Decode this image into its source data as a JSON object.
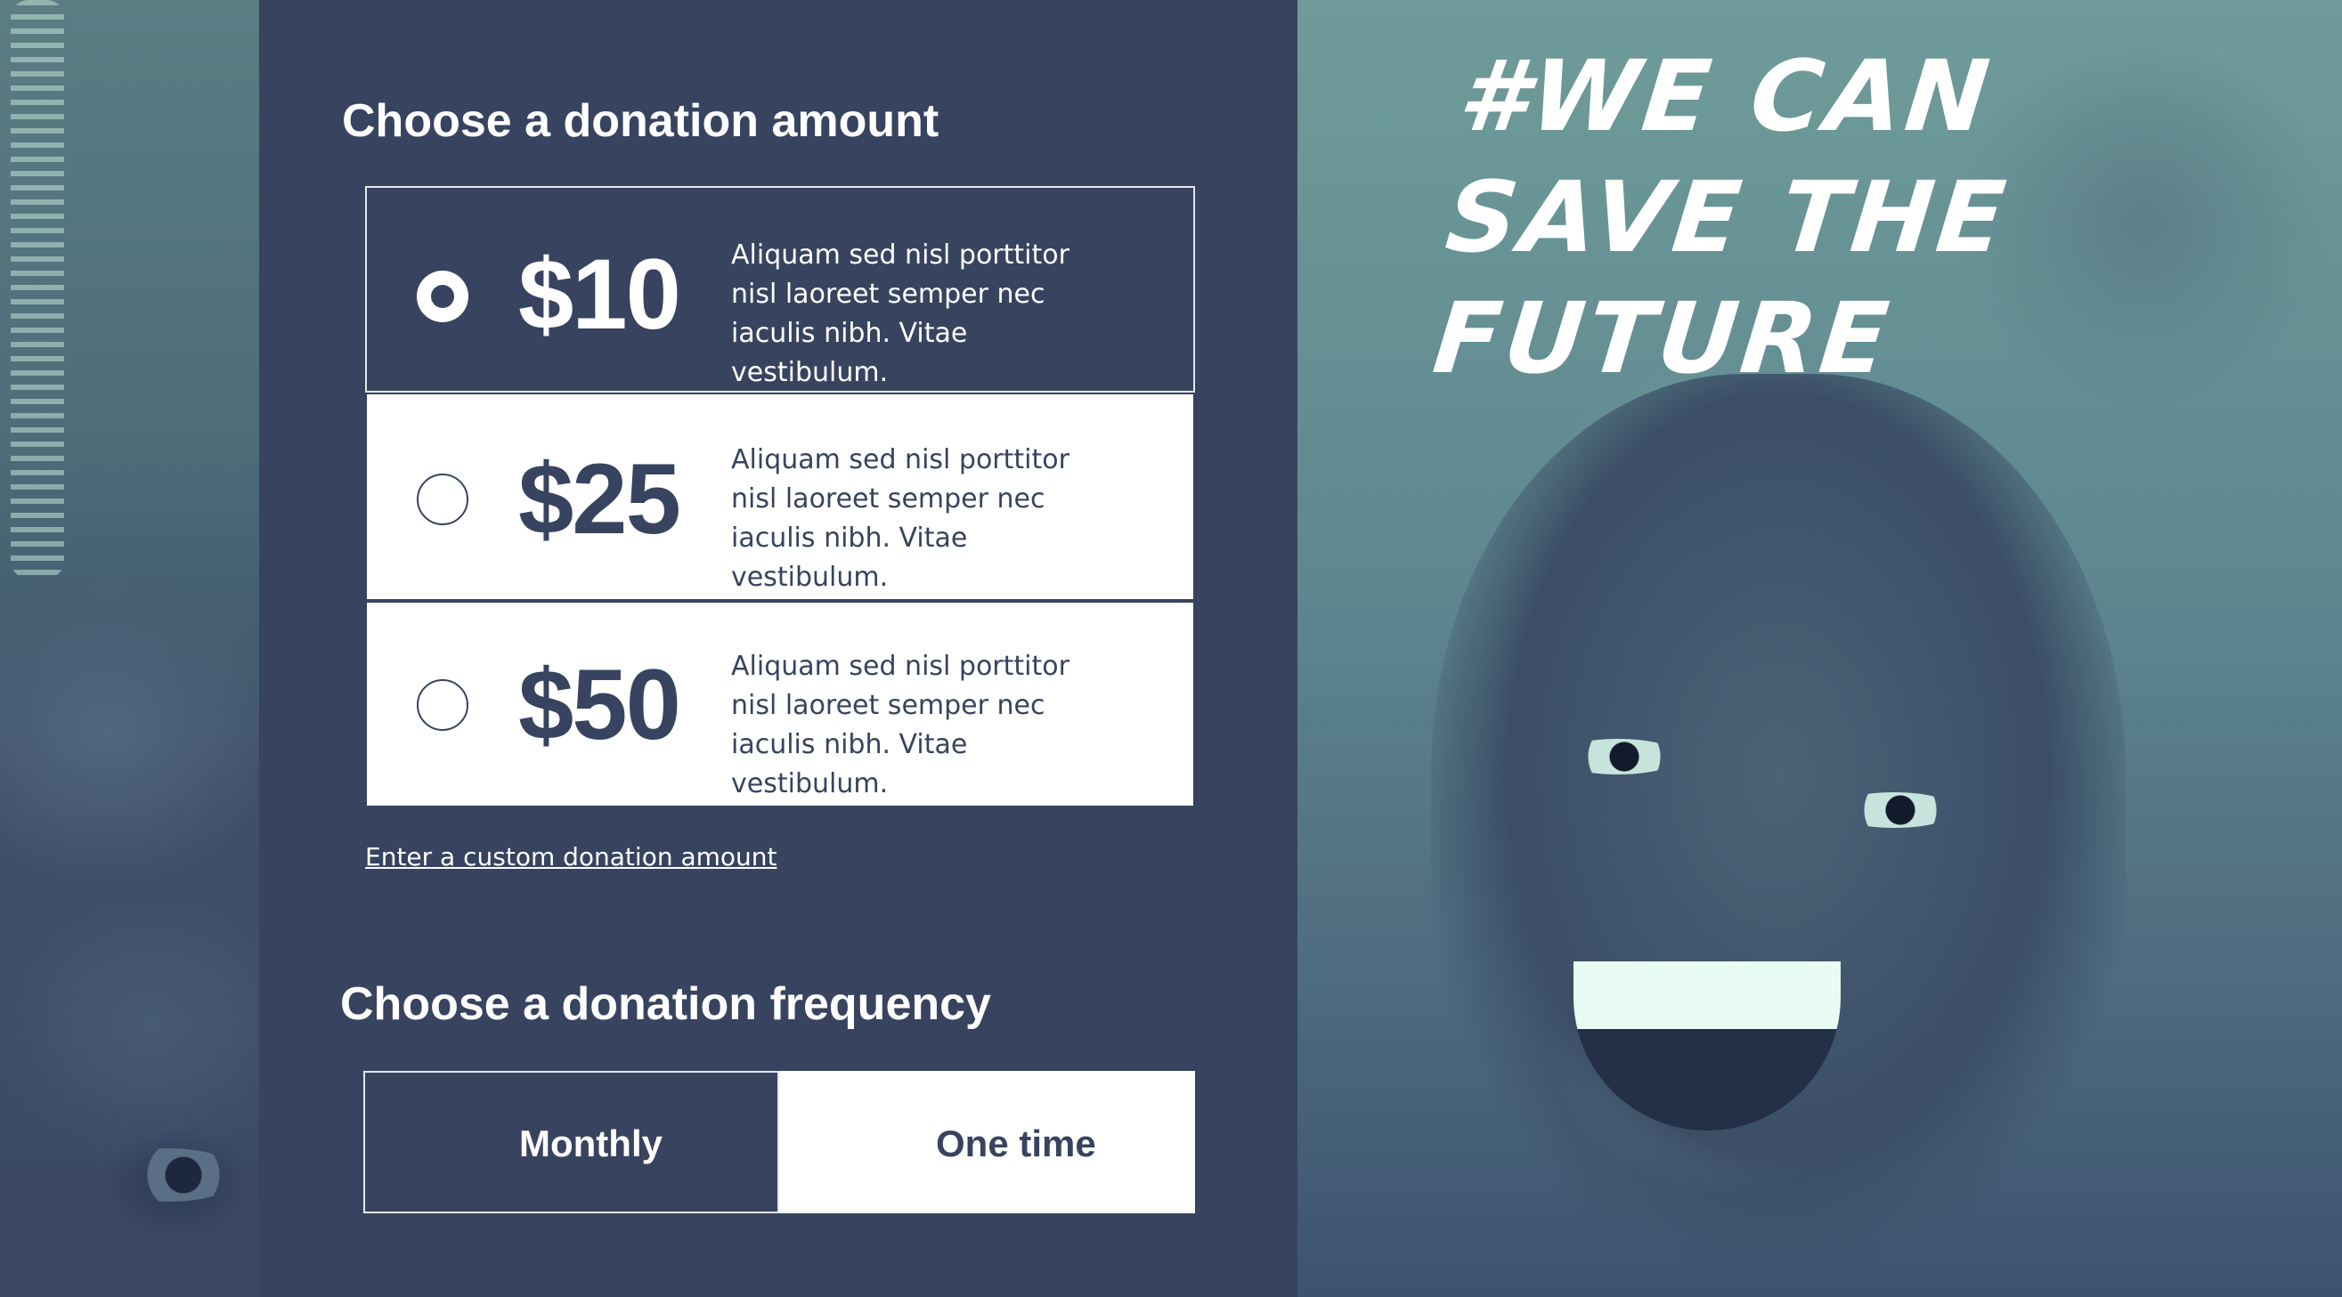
{
  "amount_section": {
    "title": "Choose a donation amount",
    "options": [
      {
        "amount": "$10",
        "description": "Aliquam sed nisl porttitor nisl laoreet semper nec iaculis nibh. Vitae vestibulum.",
        "selected": true
      },
      {
        "amount": "$25",
        "description": "Aliquam sed nisl porttitor nisl laoreet semper nec iaculis nibh. Vitae vestibulum.",
        "selected": false
      },
      {
        "amount": "$50",
        "description": "Aliquam sed nisl porttitor nisl laoreet semper nec iaculis nibh. Vitae vestibulum.",
        "selected": false
      }
    ],
    "custom_link": "Enter a custom donation amount"
  },
  "frequency_section": {
    "title": "Choose a donation frequency",
    "options": [
      {
        "label": "Monthly",
        "selected": true
      },
      {
        "label": "One time",
        "selected": false
      }
    ]
  },
  "hero": {
    "slogan_lines": [
      "#WE CAN",
      "SAVE THE",
      "FUTURE"
    ]
  },
  "colors": {
    "panel": "#37435f",
    "photo_tint": "#7fa7a4",
    "text_light": "#ffffff"
  }
}
